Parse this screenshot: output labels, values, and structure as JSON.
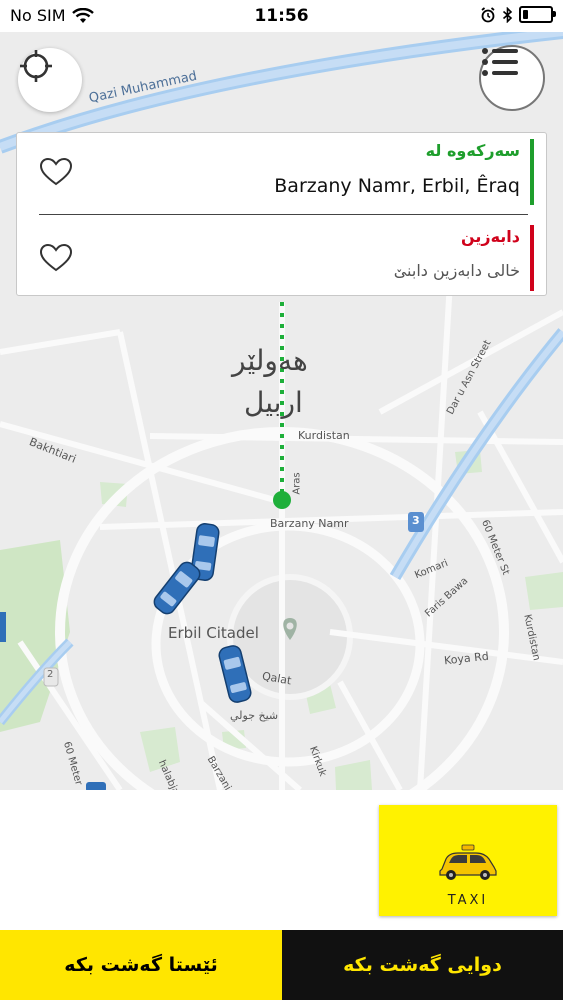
{
  "status": {
    "carrier": "No SIM",
    "time": "11:56",
    "icons": [
      "wifi-icon",
      "alarm-icon",
      "bluetooth-icon",
      "battery-icon"
    ],
    "battery_level": 0.2
  },
  "map": {
    "city_label_ku": "هەولێر",
    "city_label_ar": "اربیل",
    "streets": {
      "qazi": "Qazi Muhammad",
      "bakhtiari": "Bakhtiari",
      "kurdistan": "Kurdistan",
      "barzany": "Barzany Namr",
      "aras": "Aras",
      "dar_u_asn": "Dar u Asn Street",
      "sixty_meter": "60 Meter St",
      "komari": "Komari",
      "faris": "Faris Bawa",
      "kurdistan_vertical": "Kurdistan",
      "koya": "Koya Rd",
      "qalat": "Qalat",
      "sheikh": "شیخ جولي",
      "kirkuk": "Kirkuk",
      "barzani": "Barzani",
      "halabja": "halabja",
      "sixty_meter_left": "60 Meter",
      "route_3": "3",
      "route_2": "2"
    },
    "citadel": "Erbil Citadel"
  },
  "route": {
    "pickup_title": "سەرکەوە لە",
    "pickup_value": "Barzany Namr, Erbil, Êraq",
    "dropoff_title": "دابەزین",
    "dropoff_placeholder": "خالی دابەزین دابنێ",
    "pickup_color": "#1e9e2c",
    "dropoff_color": "#d0021b"
  },
  "taxi": {
    "label": "TAXI"
  },
  "actions": {
    "ride_now": "ئێستا گەشت بکە",
    "ride_later": "دوایی گەشت بکە"
  },
  "colors": {
    "yellow": "#ffe600",
    "dark": "#111111",
    "map_bg": "#ececec"
  }
}
